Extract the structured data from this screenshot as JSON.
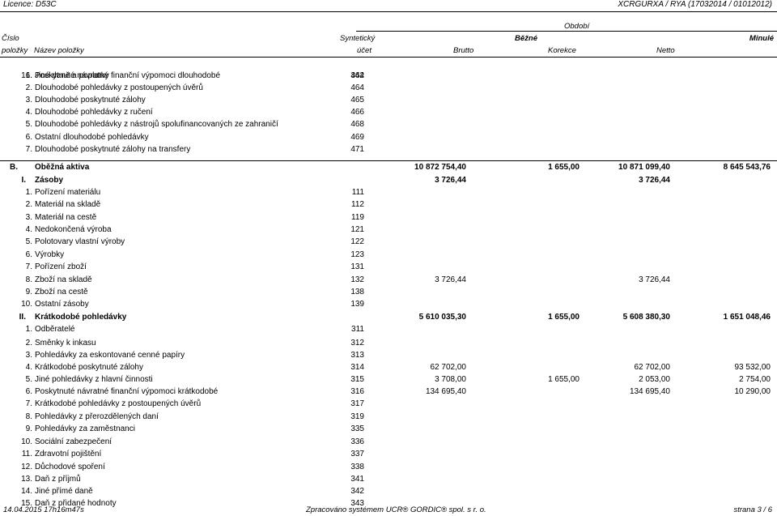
{
  "header": {
    "licence": "Licence: D53C",
    "report_id": "XCRGURXA / RYA  (17032014 / 01012012)"
  },
  "columns": {
    "obdobi": "Období",
    "cislo": "Číslo",
    "polozky": "položky",
    "nazev": "Název položky",
    "synteticky": "Syntetický",
    "ucet": "účet",
    "bezne": "Běžné",
    "minule": "Minulé",
    "brutto": "Brutto",
    "korekce": "Korekce",
    "netto": "Netto"
  },
  "rows": [
    {
      "num": "1.",
      "label": "Poskytnuté návratné finanční výpomoci dlouhodobé",
      "acc": "462",
      "v1": "",
      "v2": "",
      "v3": "",
      "v4": ""
    },
    {
      "num": "2.",
      "label": "Dlouhodobé pohledávky z postoupených úvěrů",
      "acc": "464",
      "v1": "",
      "v2": "",
      "v3": "",
      "v4": ""
    },
    {
      "num": "3.",
      "label": "Dlouhodobé poskytnuté zálohy",
      "acc": "465",
      "v1": "",
      "v2": "",
      "v3": "",
      "v4": ""
    },
    {
      "num": "4.",
      "label": "Dlouhodobé pohledávky z ručení",
      "acc": "466",
      "v1": "",
      "v2": "",
      "v3": "",
      "v4": ""
    },
    {
      "num": "5.",
      "label": "Dlouhodobé pohledávky z nástrojů spolufinancovaných ze zahraničí",
      "acc": "468",
      "v1": "",
      "v2": "",
      "v3": "",
      "v4": ""
    },
    {
      "num": "6.",
      "label": "Ostatní dlouhodobé pohledávky",
      "acc": "469",
      "v1": "",
      "v2": "",
      "v3": "",
      "v4": ""
    },
    {
      "num": "7.",
      "label": "Dlouhodobé poskytnuté zálohy na transfery",
      "acc": "471",
      "v1": "",
      "v2": "",
      "v3": "",
      "v4": ""
    },
    {
      "num": "B.",
      "label": "Oběžná aktiva",
      "acc": "",
      "v1": "10 872 754,40",
      "v2": "1 655,00",
      "v3": "10 871 099,40",
      "v4": "8 645 543,76",
      "bold": true
    },
    {
      "num": "I.",
      "label": "Zásoby",
      "acc": "",
      "v1": "3 726,44",
      "v2": "",
      "v3": "3 726,44",
      "v4": "",
      "bold": true
    },
    {
      "num": "1.",
      "label": "Pořízení materiálu",
      "acc": "111",
      "v1": "",
      "v2": "",
      "v3": "",
      "v4": ""
    },
    {
      "num": "2.",
      "label": "Materiál na skladě",
      "acc": "112",
      "v1": "",
      "v2": "",
      "v3": "",
      "v4": ""
    },
    {
      "num": "3.",
      "label": "Materiál na cestě",
      "acc": "119",
      "v1": "",
      "v2": "",
      "v3": "",
      "v4": ""
    },
    {
      "num": "4.",
      "label": "Nedokončená výroba",
      "acc": "121",
      "v1": "",
      "v2": "",
      "v3": "",
      "v4": ""
    },
    {
      "num": "5.",
      "label": "Polotovary vlastní výroby",
      "acc": "122",
      "v1": "",
      "v2": "",
      "v3": "",
      "v4": ""
    },
    {
      "num": "6.",
      "label": "Výrobky",
      "acc": "123",
      "v1": "",
      "v2": "",
      "v3": "",
      "v4": ""
    },
    {
      "num": "7.",
      "label": "Pořízení zboží",
      "acc": "131",
      "v1": "",
      "v2": "",
      "v3": "",
      "v4": ""
    },
    {
      "num": "8.",
      "label": "Zboží na skladě",
      "acc": "132",
      "v1": "3 726,44",
      "v2": "",
      "v3": "3 726,44",
      "v4": ""
    },
    {
      "num": "9.",
      "label": "Zboží na cestě",
      "acc": "138",
      "v1": "",
      "v2": "",
      "v3": "",
      "v4": ""
    },
    {
      "num": "10.",
      "label": "Ostatní zásoby",
      "acc": "139",
      "v1": "",
      "v2": "",
      "v3": "",
      "v4": ""
    },
    {
      "num": "II.",
      "label": "Krátkodobé pohledávky",
      "acc": "",
      "v1": "5 610 035,30",
      "v2": "1 655,00",
      "v3": "5 608 380,30",
      "v4": "1 651 048,46",
      "bold": true
    },
    {
      "num": "1.",
      "label": "Odběratelé",
      "acc": "311",
      "v1": "",
      "v2": "",
      "v3": "",
      "v4": ""
    },
    {
      "num": "2.",
      "label": "Směnky k inkasu",
      "acc": "312",
      "v1": "",
      "v2": "",
      "v3": "",
      "v4": ""
    },
    {
      "num": "3.",
      "label": "Pohledávky za eskontované cenné papíry",
      "acc": "313",
      "v1": "",
      "v2": "",
      "v3": "",
      "v4": ""
    },
    {
      "num": "4.",
      "label": "Krátkodobé poskytnuté zálohy",
      "acc": "314",
      "v1": "62 702,00",
      "v2": "",
      "v3": "62 702,00",
      "v4": "93 532,00"
    },
    {
      "num": "5.",
      "label": "Jiné pohledávky z hlavní činnosti",
      "acc": "315",
      "v1": "3 708,00",
      "v2": "1 655,00",
      "v3": "2 053,00",
      "v4": "2 754,00"
    },
    {
      "num": "6.",
      "label": "Poskytnuté návratné finanční výpomoci krátkodobé",
      "acc": "316",
      "v1": "134 695,40",
      "v2": "",
      "v3": "134 695,40",
      "v4": "10 290,00"
    },
    {
      "num": "7.",
      "label": "Krátkodobé pohledávky z postoupených úvěrů",
      "acc": "317",
      "v1": "",
      "v2": "",
      "v3": "",
      "v4": ""
    },
    {
      "num": "8.",
      "label": "Pohledávky z přerozdělených daní",
      "acc": "319",
      "v1": "",
      "v2": "",
      "v3": "",
      "v4": ""
    },
    {
      "num": "9.",
      "label": "Pohledávky za zaměstnanci",
      "acc": "335",
      "v1": "",
      "v2": "",
      "v3": "",
      "v4": ""
    },
    {
      "num": "10.",
      "label": "Sociální zabezpečení",
      "acc": "336",
      "v1": "",
      "v2": "",
      "v3": "",
      "v4": ""
    },
    {
      "num": "11.",
      "label": "Zdravotní pojištění",
      "acc": "337",
      "v1": "",
      "v2": "",
      "v3": "",
      "v4": ""
    },
    {
      "num": "12.",
      "label": "Důchodové spoření",
      "acc": "338",
      "v1": "",
      "v2": "",
      "v3": "",
      "v4": ""
    },
    {
      "num": "13.",
      "label": "Daň z příjmů",
      "acc": "341",
      "v1": "",
      "v2": "",
      "v3": "",
      "v4": ""
    },
    {
      "num": "14.",
      "label": "Jiné přímé daně",
      "acc": "342",
      "v1": "",
      "v2": "",
      "v3": "",
      "v4": ""
    },
    {
      "num": "15.",
      "label": "Daň z přidané hodnoty",
      "acc": "343",
      "v1": "",
      "v2": "",
      "v3": "",
      "v4": ""
    },
    {
      "num": "16.",
      "label": "Jiné daně a poplatky",
      "acc": "344",
      "v1": "",
      "v2": "",
      "v3": "",
      "v4": ""
    }
  ],
  "footer": {
    "datetime": "14.04.2015 17h16m47s",
    "processed": "Zpracováno systémem UCR® GORDIC® spol. s  r. o.",
    "page": "strana 3 / 6"
  }
}
